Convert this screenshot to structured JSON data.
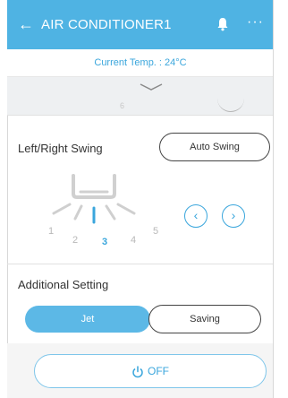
{
  "header": {
    "title": "AIR CONDITIONER1",
    "back_icon": "arrow-left-icon",
    "bell_icon": "bell-icon",
    "more_icon": "more-icon"
  },
  "current_temp": "Current Temp. : 24°C",
  "faint_digit": "6",
  "left_right_swing": {
    "title": "Left/Right Swing",
    "auto_button": "Auto Swing",
    "positions": [
      "1",
      "2",
      "3",
      "4",
      "5"
    ],
    "selected": "3"
  },
  "additional_setting": {
    "title": "Additional Setting",
    "jet": "Jet",
    "saving": "Saving",
    "jet_active": true
  },
  "power": {
    "label": "OFF"
  },
  "colors": {
    "header": "#4fb3e3",
    "accent": "#3aa6dc",
    "jet": "#5cb8e6"
  }
}
